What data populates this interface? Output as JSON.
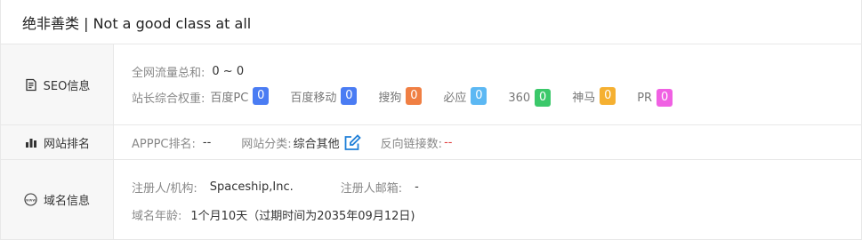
{
  "header": {
    "title": "绝非善类 | Not a good class at all"
  },
  "seo": {
    "label": "SEO信息",
    "traffic_label": "全网流量总和:",
    "traffic_value": "0 ~ 0",
    "weights_label": "站长综合权重:",
    "weights": [
      {
        "name": "百度PC",
        "value": "0",
        "color": "#4a7cf3"
      },
      {
        "name": "百度移动",
        "value": "0",
        "color": "#4a7cf3"
      },
      {
        "name": "搜狗",
        "value": "0",
        "color": "#f07f43"
      },
      {
        "name": "必应",
        "value": "0",
        "color": "#5cb8f3"
      },
      {
        "name": "360",
        "value": "0",
        "color": "#3bc86a"
      },
      {
        "name": "神马",
        "value": "0",
        "color": "#f5b031"
      },
      {
        "name": "PR",
        "value": "0",
        "color": "#f061e3"
      }
    ]
  },
  "ranking": {
    "label": "网站排名",
    "apppc_label": "APPPC排名:",
    "apppc_value": "--",
    "category_label": "网站分类:",
    "category_value": "综合其他",
    "backlinks_label": "反向链接数:",
    "backlinks_value": "--"
  },
  "domain": {
    "label": "域名信息",
    "registrant_label": "注册人/机构:",
    "registrant_value": "Spaceship,Inc.",
    "email_label": "注册人邮箱:",
    "email_value": "-",
    "age_label": "域名年龄:",
    "age_value": "1个月10天（过期时间为2035年09月12日)"
  },
  "colors": {
    "accent": "#1e7fd8",
    "red": "#e03b3b"
  }
}
